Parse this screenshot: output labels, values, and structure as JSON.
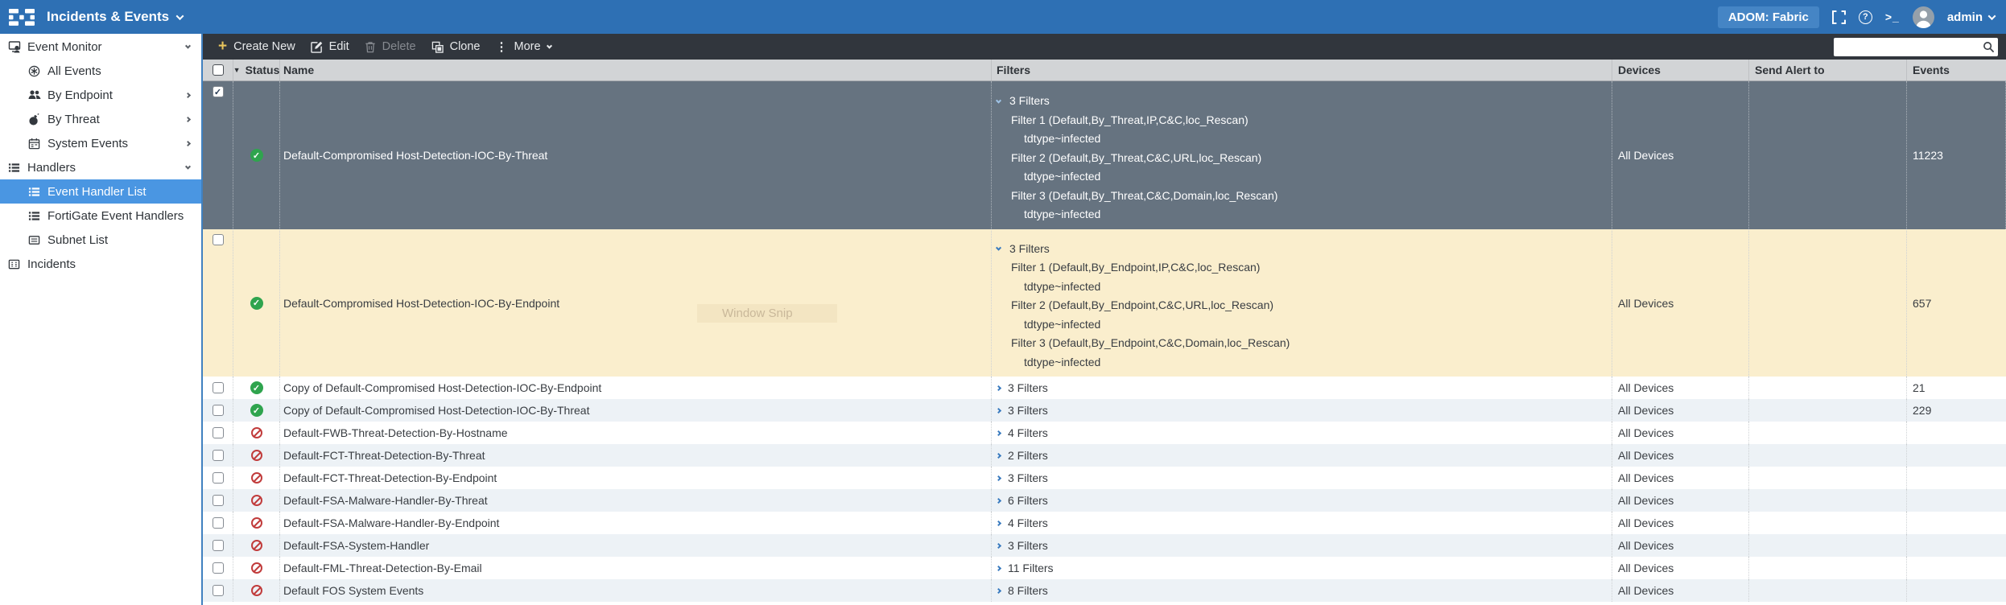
{
  "app": {
    "title": "Incidents & Events",
    "adom_label": "ADOM: Fabric",
    "user": "admin"
  },
  "icons": {
    "create_plus": "+",
    "more_dots": "⋮",
    "cli": ">_",
    "help": "?",
    "check": "✓",
    "sort_desc": "▼"
  },
  "colors": {
    "topbar_blue": "#2e70b4",
    "toolbar_dark": "#31363d",
    "selected_row": "#667380",
    "highlight_row": "#faeecd",
    "alt_row": "#edf2f6",
    "sidebar_selected": "#4a96e2",
    "status_enabled_green": "#2fa44e",
    "status_disabled_red": "#c13c3c",
    "link_blue": "#3a7bbf"
  },
  "toolbar": {
    "create_new": "Create New",
    "edit": "Edit",
    "delete": "Delete",
    "clone": "Clone",
    "more": "More",
    "search_value": ""
  },
  "sidebar": {
    "items": [
      {
        "label": "Event Monitor"
      },
      {
        "label": "All Events"
      },
      {
        "label": "By Endpoint"
      },
      {
        "label": "By Threat"
      },
      {
        "label": "System Events"
      },
      {
        "label": "Handlers"
      },
      {
        "label": "Event Handler List",
        "selected": true
      },
      {
        "label": "FortiGate Event Handlers"
      },
      {
        "label": "Subnet List"
      },
      {
        "label": "Incidents"
      }
    ]
  },
  "table": {
    "columns": [
      "Status",
      "Name",
      "Filters",
      "Devices",
      "Send Alert to",
      "Events"
    ],
    "rows": [
      {
        "name": "Default-Compromised Host-Detection-IOC-By-Threat",
        "status": "enabled",
        "checked": true,
        "selected": true,
        "filters_summary": "3 Filters",
        "filters": [
          {
            "label": "Filter 1 (Default,By_Threat,IP,C&C,loc_Rescan)",
            "condition": "tdtype~infected"
          },
          {
            "label": "Filter 2 (Default,By_Threat,C&C,URL,loc_Rescan)",
            "condition": "tdtype~infected"
          },
          {
            "label": "Filter 3 (Default,By_Threat,C&C,Domain,loc_Rescan)",
            "condition": "tdtype~infected"
          }
        ],
        "devices": "All Devices",
        "send_alert_to": "",
        "events": "11223"
      },
      {
        "name": "Default-Compromised Host-Detection-IOC-By-Endpoint",
        "status": "enabled",
        "checked": false,
        "highlighted": true,
        "filters_summary": "3 Filters",
        "filters": [
          {
            "label": "Filter 1 (Default,By_Endpoint,IP,C&C,loc_Rescan)",
            "condition": "tdtype~infected"
          },
          {
            "label": "Filter 2 (Default,By_Endpoint,C&C,URL,loc_Rescan)",
            "condition": "tdtype~infected"
          },
          {
            "label": "Filter 3 (Default,By_Endpoint,C&C,Domain,loc_Rescan)",
            "condition": "tdtype~infected"
          }
        ],
        "devices": "All Devices",
        "send_alert_to": "",
        "events": "657"
      },
      {
        "name": "Copy of Default-Compromised Host-Detection-IOC-By-Endpoint",
        "status": "enabled",
        "filters_summary": "3 Filters",
        "devices": "All Devices",
        "send_alert_to": "",
        "events": "21"
      },
      {
        "name": "Copy of Default-Compromised Host-Detection-IOC-By-Threat",
        "status": "enabled",
        "filters_summary": "3 Filters",
        "devices": "All Devices",
        "send_alert_to": "",
        "events": "229"
      },
      {
        "name": "Default-FWB-Threat-Detection-By-Hostname",
        "status": "disabled",
        "filters_summary": "4 Filters",
        "devices": "All Devices",
        "send_alert_to": "",
        "events": ""
      },
      {
        "name": "Default-FCT-Threat-Detection-By-Threat",
        "status": "disabled",
        "filters_summary": "2 Filters",
        "devices": "All Devices",
        "send_alert_to": "",
        "events": ""
      },
      {
        "name": "Default-FCT-Threat-Detection-By-Endpoint",
        "status": "disabled",
        "filters_summary": "3 Filters",
        "devices": "All Devices",
        "send_alert_to": "",
        "events": ""
      },
      {
        "name": "Default-FSA-Malware-Handler-By-Threat",
        "status": "disabled",
        "filters_summary": "6 Filters",
        "devices": "All Devices",
        "send_alert_to": "",
        "events": ""
      },
      {
        "name": "Default-FSA-Malware-Handler-By-Endpoint",
        "status": "disabled",
        "filters_summary": "4 Filters",
        "devices": "All Devices",
        "send_alert_to": "",
        "events": ""
      },
      {
        "name": "Default-FSA-System-Handler",
        "status": "disabled",
        "filters_summary": "3 Filters",
        "devices": "All Devices",
        "send_alert_to": "",
        "events": ""
      },
      {
        "name": "Default-FML-Threat-Detection-By-Email",
        "status": "disabled",
        "filters_summary": "11 Filters",
        "devices": "All Devices",
        "send_alert_to": "",
        "events": ""
      },
      {
        "name": "Default FOS System Events",
        "status": "disabled",
        "filters_summary": "8 Filters",
        "devices": "All Devices",
        "send_alert_to": "",
        "events": ""
      }
    ]
  },
  "watermark": "Window Snip"
}
